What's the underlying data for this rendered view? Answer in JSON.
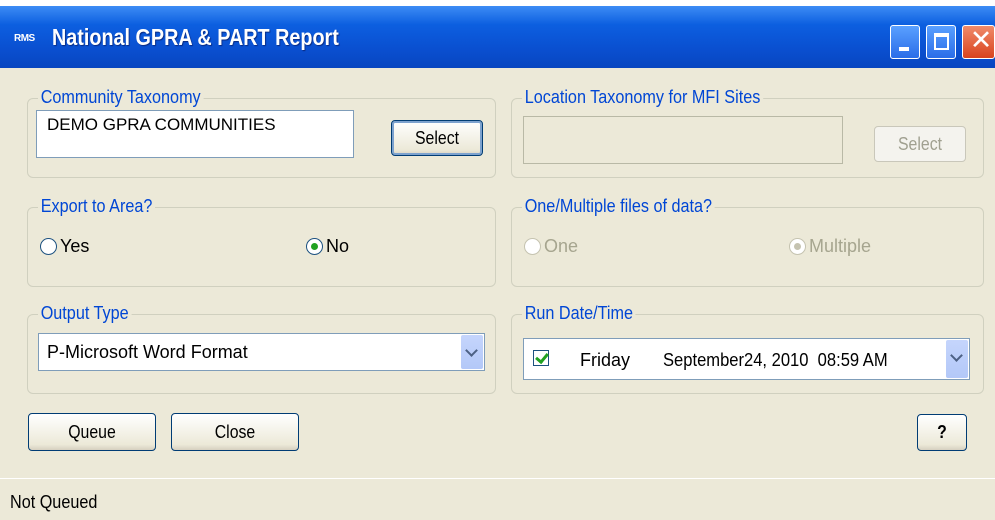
{
  "window": {
    "title": "National GPRA & PART Report",
    "icon_text": "RMS",
    "buttons": [
      "minimize-icon",
      "maximize-icon",
      "close-icon"
    ]
  },
  "community_taxonomy": {
    "legend": "Community Taxonomy",
    "value": "DEMO GPRA COMMUNITIES",
    "select_label": "Select"
  },
  "location_taxonomy": {
    "legend": "Location Taxonomy for MFI Sites",
    "value": "",
    "select_label": "Select"
  },
  "export_area": {
    "legend": "Export to Area?",
    "yes_label": "Yes",
    "no_label": "No",
    "selected": "No"
  },
  "files": {
    "legend": "One/Multiple files of data?",
    "one_label": "One",
    "multiple_label": "Multiple",
    "selected": "Multiple"
  },
  "output_type": {
    "legend": "Output Type",
    "value": "P-Microsoft Word Format"
  },
  "run_date": {
    "legend": "Run Date/Time",
    "checked": true,
    "day": "Friday",
    "datetime": "September24, 2010  08:59 AM"
  },
  "actions": {
    "queue_label": "Queue",
    "close_label": "Close",
    "help_label": "?"
  },
  "status": {
    "text": "Not Queued"
  },
  "colors": {
    "titlebar": "#0a4fd0",
    "legend_text": "#0046d5",
    "dialog_bg": "#ece9d8"
  }
}
